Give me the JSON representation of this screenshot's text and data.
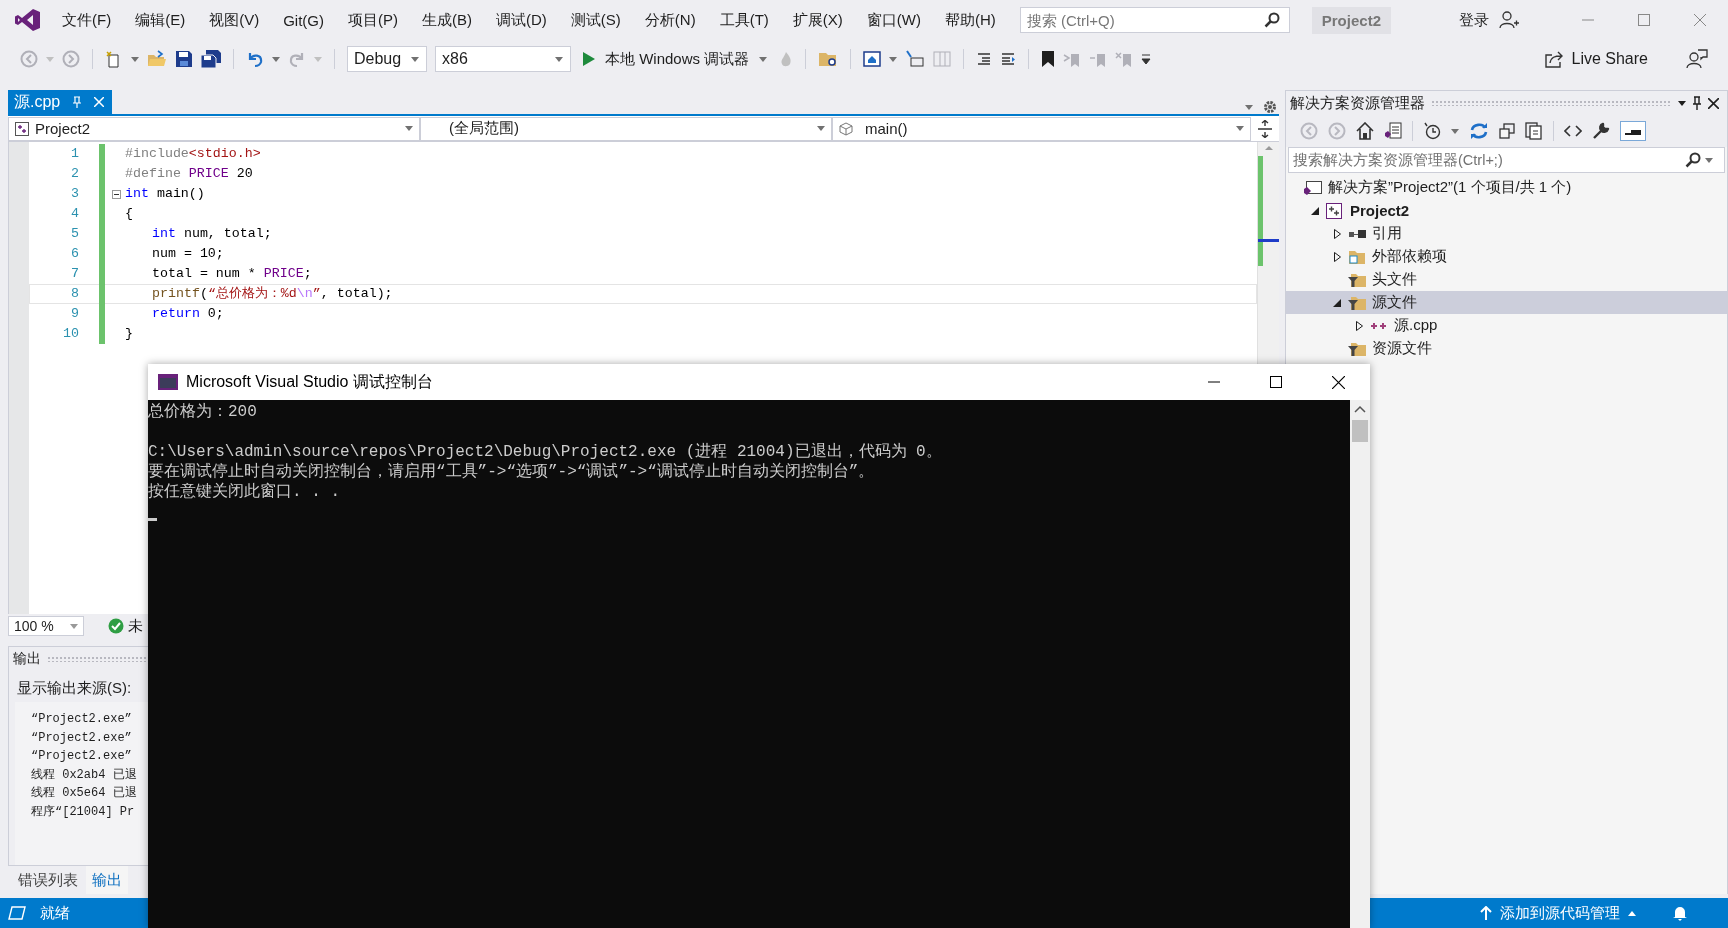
{
  "menu_bar": {
    "items": [
      "文件(F)",
      "编辑(E)",
      "视图(V)",
      "Git(G)",
      "项目(P)",
      "生成(B)",
      "调试(D)",
      "测试(S)",
      "分析(N)",
      "工具(T)",
      "扩展(X)",
      "窗口(W)",
      "帮助(H)"
    ],
    "search": {
      "placeholder": "搜索 (Ctrl+Q)"
    },
    "solution_name": "Project2",
    "sign_in": "登录"
  },
  "toolbar": {
    "configuration": "Debug",
    "platform": "x86",
    "run_label": "本地 Windows 调试器",
    "live_share": "Live Share"
  },
  "document_tabs": [
    {
      "label": "源.cpp",
      "selected": true
    }
  ],
  "navigation_bar": {
    "project": "Project2",
    "scope": "(全局范围)",
    "member": "main()"
  },
  "editor": {
    "lines": [
      {
        "number": "1",
        "indented": false,
        "current": false,
        "tokens": [
          {
            "kind": "preproc",
            "text": "#include"
          },
          {
            "kind": "string",
            "text": "<stdio.h>"
          }
        ]
      },
      {
        "number": "2",
        "indented": false,
        "current": false,
        "tokens": [
          {
            "kind": "preproc",
            "text": "#define "
          },
          {
            "kind": "macro",
            "text": "PRICE"
          },
          {
            "kind": "plain",
            "text": " 20"
          }
        ]
      },
      {
        "number": "3",
        "indented": false,
        "foldable": true,
        "current": false,
        "tokens": [
          {
            "kind": "keyword",
            "text": "int"
          },
          {
            "kind": "plain",
            "text": " main()"
          }
        ]
      },
      {
        "number": "4",
        "indented": false,
        "current": false,
        "tokens": [
          {
            "kind": "plain",
            "text": "{"
          }
        ]
      },
      {
        "number": "5",
        "indented": true,
        "current": false,
        "tokens": [
          {
            "kind": "keyword",
            "text": "int"
          },
          {
            "kind": "plain",
            "text": " num, total;"
          }
        ]
      },
      {
        "number": "6",
        "indented": true,
        "current": false,
        "tokens": [
          {
            "kind": "plain",
            "text": "num = 10;"
          }
        ]
      },
      {
        "number": "7",
        "indented": true,
        "current": false,
        "tokens": [
          {
            "kind": "plain",
            "text": "total = num * "
          },
          {
            "kind": "macro",
            "text": "PRICE"
          },
          {
            "kind": "plain",
            "text": ";"
          }
        ]
      },
      {
        "number": "8",
        "indented": true,
        "current": true,
        "tokens": [
          {
            "kind": "function",
            "text": "printf"
          },
          {
            "kind": "plain",
            "text": "("
          },
          {
            "kind": "string",
            "text": "“总价格为：%d"
          },
          {
            "kind": "escape",
            "text": "\\n"
          },
          {
            "kind": "string",
            "text": "”"
          },
          {
            "kind": "plain",
            "text": ", total);"
          }
        ]
      },
      {
        "number": "9",
        "indented": true,
        "current": false,
        "tokens": [
          {
            "kind": "keyword",
            "text": "return"
          },
          {
            "kind": "plain",
            "text": " 0;"
          }
        ]
      },
      {
        "number": "10",
        "indented": false,
        "current": false,
        "tokens": [
          {
            "kind": "plain",
            "text": "}"
          }
        ]
      }
    ]
  },
  "zoom": "100 %",
  "status_indicator": "未",
  "output": {
    "title": "输出",
    "source_label": "显示输出来源(S):",
    "lines": [
      "“Project2.exe”",
      "“Project2.exe”",
      "“Project2.exe”",
      "线程 0x2ab4 已退",
      "线程 0x5e64 已退",
      "程序“[21004] Pr"
    ]
  },
  "bottom_tabs": [
    {
      "label": "错误列表",
      "selected": false
    },
    {
      "label": "输出",
      "selected": true
    }
  ],
  "solution_explorer": {
    "title": "解决方案资源管理器",
    "search": {
      "placeholder": "搜索解决方案资源管理器(Ctrl+;)"
    },
    "tree": [
      {
        "label": "解决方案”Project2”(1 个项目/共 1 个)",
        "kind": "solution",
        "expandable": false,
        "selected": false,
        "children": [
          {
            "label": "Project2",
            "kind": "project",
            "expandable": true,
            "expanded": true,
            "selected": false,
            "children": [
              {
                "label": "引用",
                "kind": "references",
                "expandable": true,
                "expanded": false,
                "selected": false
              },
              {
                "label": "外部依赖项",
                "kind": "external",
                "expandable": true,
                "expanded": false,
                "selected": false
              },
              {
                "label": "头文件",
                "kind": "filter",
                "expandable": false,
                "selected": false
              },
              {
                "label": "源文件",
                "kind": "filter",
                "expandable": true,
                "expanded": true,
                "selected": true,
                "children": [
                  {
                    "label": "源.cpp",
                    "kind": "cpp",
                    "expandable": true,
                    "expanded": false,
                    "selected": false
                  }
                ]
              },
              {
                "label": "资源文件",
                "kind": "filter",
                "expandable": false,
                "selected": false
              }
            ]
          }
        ]
      }
    ]
  },
  "console": {
    "title": "Microsoft Visual Studio 调试控制台",
    "groups": [
      [
        "总价格为：200"
      ],
      [
        "C:\\Users\\admin\\source\\repos\\Project2\\Debug\\Project2.exe (进程 21004)已退出，代码为 0。",
        "要在调试停止时自动关闭控制台，请启用“工具”->“选项”->“调试”->“调试停止时自动关闭控制台”。",
        "按任意键关闭此窗口. . ."
      ]
    ]
  },
  "status_bar": {
    "state": "就绪",
    "source_control": "添加到源代码管理"
  }
}
